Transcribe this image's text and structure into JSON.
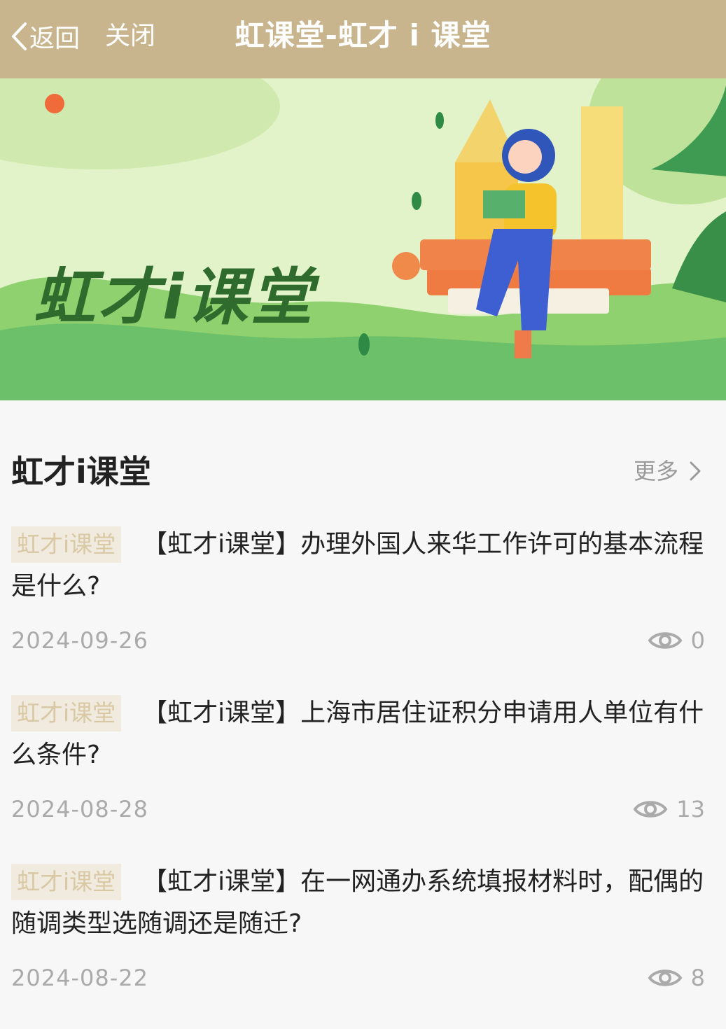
{
  "nav": {
    "back_label": "返回",
    "close_label": "关闭",
    "title": "虹课堂-虹才 i 课堂"
  },
  "banner": {
    "text": "虹才i课堂"
  },
  "section": {
    "title": "虹才i课堂",
    "more_label": "更多"
  },
  "articles": [
    {
      "tag": "虹才i课堂",
      "title": "【虹才i课堂】办理外国人来华工作许可的基本流程是什么?",
      "date": "2024-09-26",
      "views": "0"
    },
    {
      "tag": "虹才i课堂",
      "title": "【虹才i课堂】上海市居住证积分申请用人单位有什么条件?",
      "date": "2024-08-28",
      "views": "13"
    },
    {
      "tag": "虹才i课堂",
      "title": "【虹才i课堂】在一网通办系统填报材料时，配偶的随调类型选随调还是随迁?",
      "date": "2024-08-22",
      "views": "8"
    }
  ],
  "colors": {
    "navbar": "#c8b58d",
    "tag_bg": "#f1ebdf",
    "tag_text": "#d9c8a4",
    "meta_text": "#aaaaaa",
    "banner_text": "#2f6b2d"
  }
}
